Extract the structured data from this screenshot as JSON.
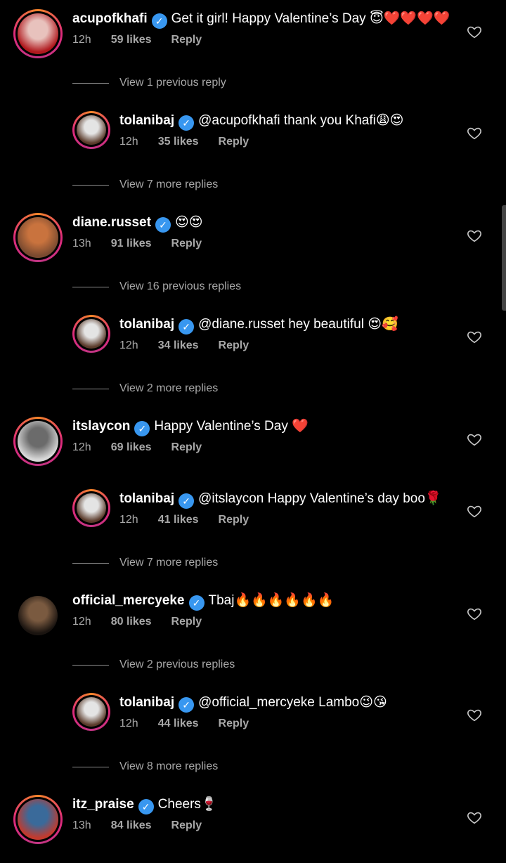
{
  "verified_glyph": "✓",
  "items": [
    {
      "type": "comment",
      "level": 0,
      "user": "acupofkhafi",
      "text": "Get it girl! Happy Valentine’s Day 😇❤️❤️❤️❤️",
      "time": "12h",
      "likes": "59 likes",
      "reply": "Reply",
      "avatar_colors": [
        "#b0181d",
        "#e8c2bd"
      ]
    },
    {
      "type": "view",
      "text": "View 1 previous reply"
    },
    {
      "type": "comment",
      "level": 1,
      "user": "tolanibaj",
      "text": "@acupofkhafi thank you Khafi😩😍",
      "time": "12h",
      "likes": "35 likes",
      "reply": "Reply",
      "avatar_colors": [
        "#5a3a2a",
        "#e4e4e4"
      ]
    },
    {
      "type": "view",
      "text": "View 7 more replies"
    },
    {
      "type": "comment",
      "level": 0,
      "user": "diane.russet",
      "text": "😍😍",
      "time": "13h",
      "likes": "91 likes",
      "reply": "Reply",
      "avatar_colors": [
        "#7a4a30",
        "#c9733e"
      ]
    },
    {
      "type": "view",
      "text": "View 16 previous replies"
    },
    {
      "type": "comment",
      "level": 1,
      "user": "tolanibaj",
      "text": "@diane.russet hey beautiful 😍🥰",
      "time": "12h",
      "likes": "34 likes",
      "reply": "Reply",
      "avatar_colors": [
        "#5a3a2a",
        "#e4e4e4"
      ]
    },
    {
      "type": "view",
      "text": "View 2 more replies"
    },
    {
      "type": "comment",
      "level": 0,
      "user": "itslaycon",
      "text": "Happy Valentine’s Day ❤️",
      "time": "12h",
      "likes": "69 likes",
      "reply": "Reply",
      "avatar_colors": [
        "#d8d8d8",
        "#6b6b6b"
      ]
    },
    {
      "type": "comment",
      "level": 1,
      "user": "tolanibaj",
      "text": "@itslaycon Happy Valentine’s day boo🌹",
      "time": "12h",
      "likes": "41 likes",
      "reply": "Reply",
      "avatar_colors": [
        "#5a3a2a",
        "#e4e4e4"
      ]
    },
    {
      "type": "view",
      "text": "View 7 more replies"
    },
    {
      "type": "comment",
      "level": 0,
      "user": "official_mercyeke",
      "text": "Tbaj🔥🔥🔥🔥🔥🔥",
      "time": "12h",
      "likes": "80 likes",
      "reply": "Reply",
      "avatar_colors": [
        "#1a1410",
        "#7a5a40"
      ],
      "no_ring": true
    },
    {
      "type": "view",
      "text": "View 2 previous replies"
    },
    {
      "type": "comment",
      "level": 1,
      "user": "tolanibaj",
      "text": "@official_mercyeke Lambo😉😘",
      "time": "12h",
      "likes": "44 likes",
      "reply": "Reply",
      "avatar_colors": [
        "#5a3a2a",
        "#e4e4e4"
      ]
    },
    {
      "type": "view",
      "text": "View 8 more replies"
    },
    {
      "type": "comment",
      "level": 0,
      "user": "itz_praise",
      "text": "Cheers🍷",
      "time": "13h",
      "likes": "84 likes",
      "reply": "Reply",
      "avatar_colors": [
        "#c23a2e",
        "#3a6a9a"
      ]
    }
  ]
}
